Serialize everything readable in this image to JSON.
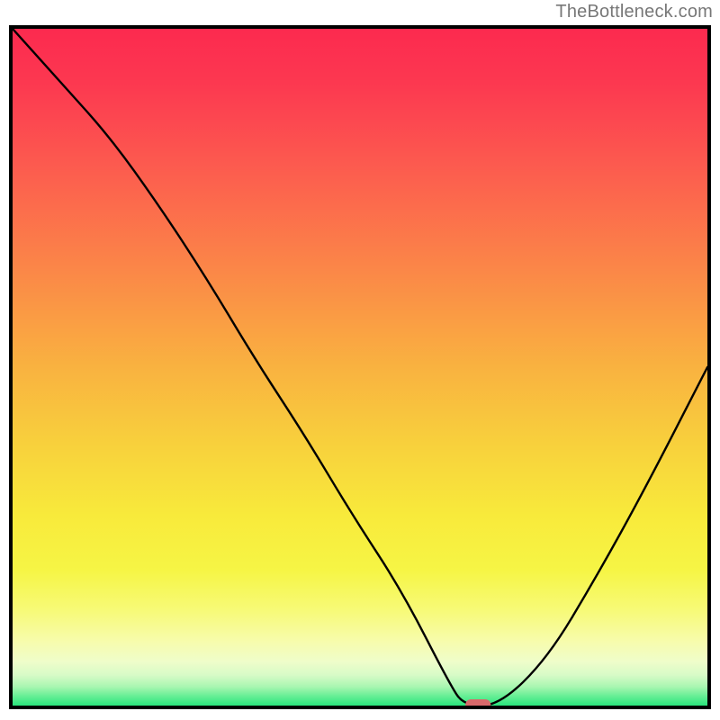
{
  "attribution": "TheBottleneck.com",
  "chart_data": {
    "type": "line",
    "title": "",
    "xlabel": "",
    "ylabel": "",
    "xlim": [
      0,
      100
    ],
    "ylim": [
      0,
      100
    ],
    "grid": false,
    "legend": false,
    "background": "red-yellow-green vertical gradient",
    "series": [
      {
        "name": "curve",
        "x": [
          0,
          7,
          14,
          21,
          28,
          35,
          42,
          49,
          56,
          63,
          65,
          70,
          77,
          84,
          91,
          100
        ],
        "y": [
          100,
          92,
          84,
          74,
          63,
          51,
          40,
          28,
          17,
          3,
          0,
          0,
          7,
          19,
          32,
          50
        ]
      }
    ],
    "marker": {
      "x": 67,
      "y": 0,
      "color": "#d9696b",
      "shape": "rounded-rect"
    },
    "gradient_stops": [
      {
        "offset": 0.0,
        "color": "#fc2a4f"
      },
      {
        "offset": 0.08,
        "color": "#fc3850"
      },
      {
        "offset": 0.2,
        "color": "#fc5a4f"
      },
      {
        "offset": 0.35,
        "color": "#fb8548"
      },
      {
        "offset": 0.5,
        "color": "#f9b240"
      },
      {
        "offset": 0.62,
        "color": "#f8d23c"
      },
      {
        "offset": 0.72,
        "color": "#f8ea3b"
      },
      {
        "offset": 0.8,
        "color": "#f6f545"
      },
      {
        "offset": 0.86,
        "color": "#f7fa78"
      },
      {
        "offset": 0.905,
        "color": "#f7fcac"
      },
      {
        "offset": 0.935,
        "color": "#effdca"
      },
      {
        "offset": 0.955,
        "color": "#d7fbc7"
      },
      {
        "offset": 0.972,
        "color": "#a9f6b1"
      },
      {
        "offset": 0.985,
        "color": "#6bef97"
      },
      {
        "offset": 1.0,
        "color": "#2ae57c"
      }
    ]
  }
}
